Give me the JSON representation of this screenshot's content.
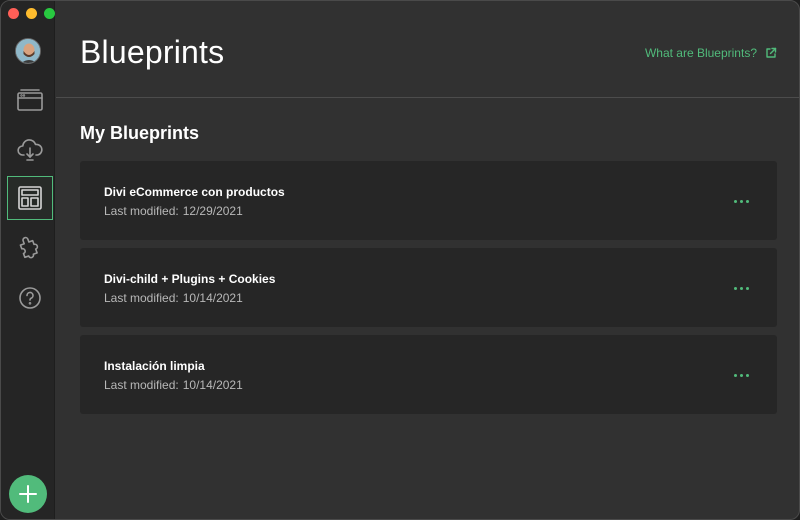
{
  "window": {
    "controls": [
      "close",
      "minimize",
      "zoom"
    ]
  },
  "sidebar": {
    "items": [
      {
        "name": "local-sites",
        "icon": "browser-window-icon",
        "active": false
      },
      {
        "name": "connect",
        "icon": "cloud-download-icon",
        "active": false
      },
      {
        "name": "blueprints",
        "icon": "blueprint-layout-icon",
        "active": true
      },
      {
        "name": "addons",
        "icon": "puzzle-piece-icon",
        "active": false
      },
      {
        "name": "help",
        "icon": "help-question-icon",
        "active": false
      }
    ],
    "add_icon": "plus-icon"
  },
  "header": {
    "title": "Blueprints",
    "help_link": "What are Blueprints?",
    "help_link_icon": "external-link-icon"
  },
  "main": {
    "section_title": "My Blueprints",
    "meta_label": "Last modified:",
    "blueprints": [
      {
        "name": "Divi eCommerce con productos",
        "modified": "12/29/2021"
      },
      {
        "name": "Divi-child + Plugins + Cookies",
        "modified": "10/14/2021"
      },
      {
        "name": "Instalación limpia",
        "modified": "10/14/2021"
      }
    ]
  },
  "colors": {
    "accent": "#51bb7b",
    "background": "#313131",
    "sidebar": "#252525",
    "card": "#262626"
  }
}
